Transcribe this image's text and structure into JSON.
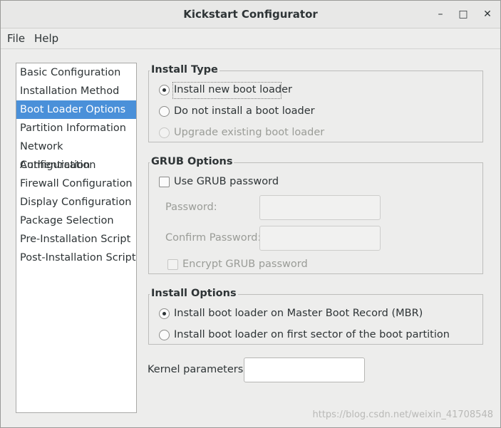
{
  "window": {
    "title": "Kickstart Configurator"
  },
  "menubar": {
    "items": [
      "File",
      "Help"
    ]
  },
  "sidebar": {
    "items": [
      {
        "label": "Basic Configuration"
      },
      {
        "label": "Installation Method"
      },
      {
        "label": "Boot Loader Options",
        "selected": true
      },
      {
        "label": "Partition Information"
      },
      {
        "label": "Network Configuration"
      },
      {
        "label": "Authentication"
      },
      {
        "label": "Firewall Configuration"
      },
      {
        "label": "Display Configuration"
      },
      {
        "label": "Package Selection"
      },
      {
        "label": "Pre-Installation Script"
      },
      {
        "label": "Post-Installation Script"
      }
    ]
  },
  "install_type": {
    "title": "Install Type",
    "options": [
      {
        "label": "Install new boot loader",
        "checked": true
      },
      {
        "label": "Do not install a boot loader",
        "checked": false
      },
      {
        "label": "Upgrade existing boot loader",
        "checked": false,
        "disabled": true
      }
    ]
  },
  "grub_options": {
    "title": "GRUB Options",
    "use_password_label": "Use GRUB password",
    "password_label": "Password:",
    "password_value": "",
    "confirm_label": "Confirm Password:",
    "confirm_value": "",
    "encrypt_label": "Encrypt GRUB password"
  },
  "install_options": {
    "title": "Install Options",
    "options": [
      {
        "label": "Install boot loader on Master Boot Record (MBR)",
        "checked": true
      },
      {
        "label": "Install boot loader on first sector of the boot partition",
        "checked": false
      }
    ]
  },
  "kernel": {
    "label": "Kernel parameters:",
    "value": ""
  },
  "watermark": "https://blog.csdn.net/weixin_41708548"
}
